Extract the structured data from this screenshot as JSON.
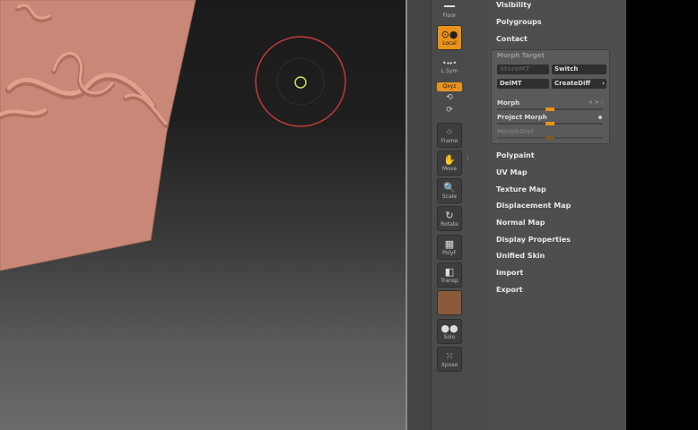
{
  "shelf": {
    "floor_label": "Floor",
    "local_label": "Local",
    "lsym_label": "L.Sym",
    "xyz_label": "Qxyz",
    "frame_label": "Frame",
    "move_label": "Move",
    "scale_label": "Scale",
    "rotate_label": "Rotate",
    "polyf_label": "PolyF",
    "transp_label": "Transp",
    "solo_label": "Solo",
    "xpose_label": "Xpose"
  },
  "panel": {
    "top_items": [
      "Visibility",
      "Polygroups",
      "Contact"
    ],
    "morph_target": {
      "title": "Morph Target",
      "storemt_label": "StoreMT",
      "switch_label": "Switch",
      "delmt_label": "DelMT",
      "creatediff_label": "CreateDiff",
      "morph_label": "Morph",
      "morph_value": 0.5,
      "project_morph_label": "Project Morph",
      "project_morph_value": 0.5,
      "morphdist_label": "MorphDist",
      "morphdist_value": 0.5
    },
    "bottom_items": [
      "Polypaint",
      "UV Map",
      "Texture Map",
      "Displacement Map",
      "Normal Map",
      "Display Properties",
      "Unified Skin",
      "Import",
      "Export"
    ]
  },
  "colors": {
    "accent": "#e8921c",
    "model_skin": "#c98877",
    "brush_ring": "#c23a3a"
  }
}
